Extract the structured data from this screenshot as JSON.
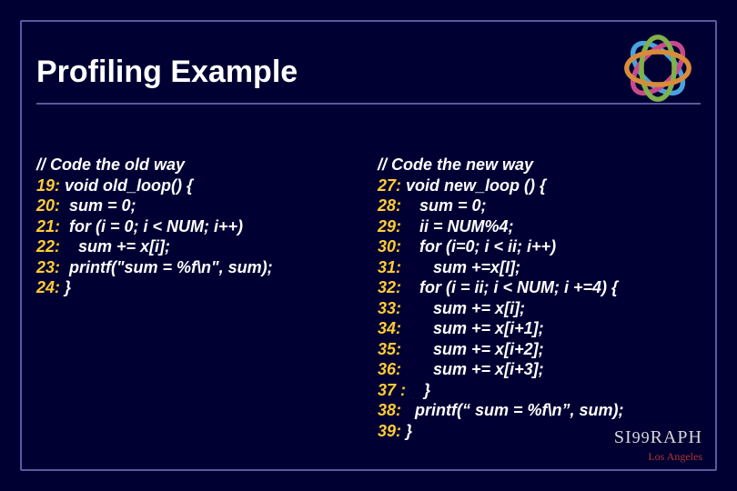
{
  "title": "Profiling Example",
  "left": {
    "heading": "// Code the old way",
    "lines": [
      {
        "n": "19:",
        "t": " void old_loop() {"
      },
      {
        "n": "20:",
        "t": "  sum = 0;"
      },
      {
        "n": "21:",
        "t": "  for (i = 0; i < NUM; i++)"
      },
      {
        "n": "22:",
        "t": "    sum += x[i];"
      },
      {
        "n": "23:",
        "t": "  printf(\"sum = %f\\n\", sum);"
      },
      {
        "n": "24:",
        "t": " }"
      }
    ]
  },
  "right": {
    "heading": "// Code the new way",
    "lines": [
      {
        "n": "27:",
        "t": " void new_loop () {"
      },
      {
        "n": "28:",
        "t": "    sum = 0;"
      },
      {
        "n": "29:",
        "t": "    ii = NUM%4;"
      },
      {
        "n": "30:",
        "t": "    for (i=0; i < ii; i++)"
      },
      {
        "n": "31:",
        "t": "       sum +=x[I];"
      },
      {
        "n": "32:",
        "t": "    for (i = ii; i < NUM; i +=4) {"
      },
      {
        "n": "33:",
        "t": "       sum += x[i];"
      },
      {
        "n": "34:",
        "t": "       sum += x[i+1];"
      },
      {
        "n": "35:",
        "t": "       sum += x[i+2];"
      },
      {
        "n": "36:",
        "t": "       sum += x[i+3];"
      },
      {
        "n": "37 :",
        "t": "    }"
      },
      {
        "n": "38:",
        "t": "   printf(“ sum = %f\\n”, sum);"
      },
      {
        "n": "39:",
        "t": " }"
      }
    ]
  },
  "footer": {
    "brand_left": "SI",
    "brand_mid": "99",
    "brand_right": "RAPH",
    "location": "Los Angeles"
  }
}
